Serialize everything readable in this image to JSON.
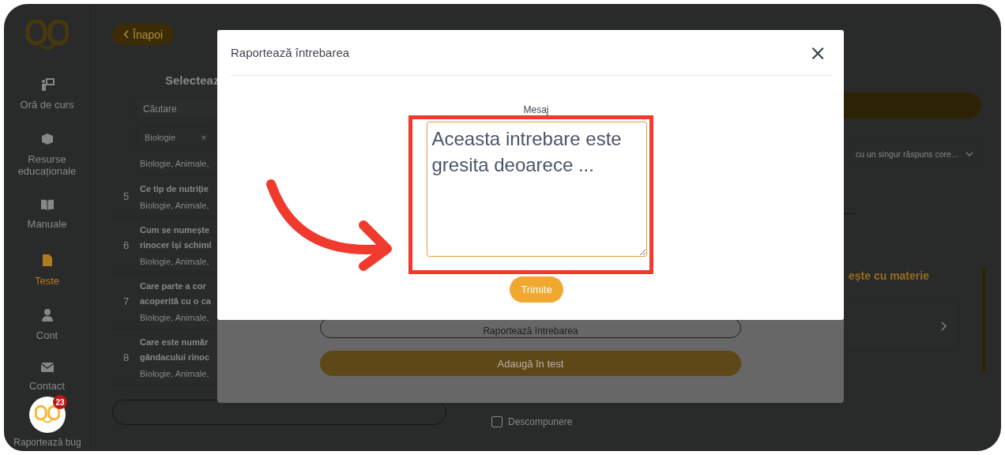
{
  "sidebar": {
    "items": [
      {
        "label": "Oră de curs",
        "selected": false
      },
      {
        "label": "Resurse educaționale",
        "selected": false
      },
      {
        "label": "Manuale",
        "selected": false
      },
      {
        "label": "Teste",
        "selected": true
      },
      {
        "label": "Cont",
        "selected": false
      },
      {
        "label": "Contact",
        "selected": false
      }
    ],
    "bug_badge": "23",
    "bug_label": "Raportează bug"
  },
  "main": {
    "back_button": "Înapoi",
    "heading": "Selecteaz",
    "search": {
      "placeholder": "Căutare"
    },
    "filter_chip": {
      "label": "Biologie",
      "remove": "×"
    },
    "first_row_tags": "Biologie, Animale,",
    "rows": [
      {
        "number": "5",
        "question": [
          "Ce tip de nutriție"
        ],
        "tags": "Biologie, Animale,"
      },
      {
        "number": "6",
        "question": [
          "Cum se numește",
          "rinocer își schiml"
        ],
        "tags": "Biologie, Animale,"
      },
      {
        "number": "7",
        "question": [
          "Care parte a cor",
          "acoperită cu o ca"
        ],
        "tags": "Biologie, Animale,"
      },
      {
        "number": "8",
        "question": [
          "Care este număr",
          "gândacului rinoc"
        ],
        "tags": "Biologie, Animale,"
      }
    ]
  },
  "right": {
    "type_dropdown": "cu un singur răspuns core...",
    "section_heading": "ește cu materie",
    "checkboxes": [
      {
        "label": "Descompunere",
        "checked": false
      }
    ]
  },
  "behind_modal": {
    "report_button": "Raportează întrebarea",
    "add_button": "Adaugă în test"
  },
  "modal": {
    "title": "Raportează întrebarea",
    "close": "×",
    "message_label": "Mesaj",
    "message": "Aceasta intrebare este gresita deoarece ... ",
    "submit": "Trimite"
  }
}
